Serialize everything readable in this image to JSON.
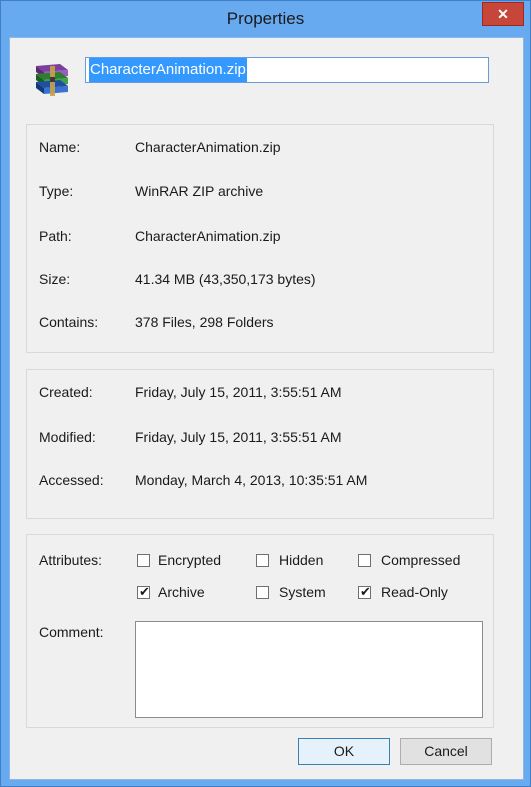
{
  "window": {
    "title": "Properties",
    "close_symbol": "✕"
  },
  "header": {
    "file_name_input": "CharacterAnimation.zip",
    "icon": "winrar-archive-icon"
  },
  "general": [
    {
      "label": "Name:",
      "value": "CharacterAnimation.zip"
    },
    {
      "label": "Type:",
      "value": "WinRAR ZIP archive"
    },
    {
      "label": "Path:",
      "value": "CharacterAnimation.zip"
    },
    {
      "label": "Size:",
      "value": "41.34 MB (43,350,173 bytes)"
    },
    {
      "label": "Contains:",
      "value": "378 Files, 298 Folders"
    }
  ],
  "dates": [
    {
      "label": "Created:",
      "value": "Friday, July 15, 2011, 3:55:51 AM"
    },
    {
      "label": "Modified:",
      "value": "Friday, July 15, 2011, 3:55:51 AM"
    },
    {
      "label": "Accessed:",
      "value": "Monday, March 4, 2013, 10:35:51 AM"
    }
  ],
  "attributes": {
    "label": "Attributes:",
    "items": [
      {
        "label": "Encrypted",
        "checked": false
      },
      {
        "label": "Hidden",
        "checked": false
      },
      {
        "label": "Compressed",
        "checked": false
      },
      {
        "label": "Archive",
        "checked": true
      },
      {
        "label": "System",
        "checked": false
      },
      {
        "label": "Read-Only",
        "checked": true
      }
    ]
  },
  "comment": {
    "label": "Comment:",
    "value": ""
  },
  "buttons": {
    "ok": "OK",
    "cancel": "Cancel"
  }
}
